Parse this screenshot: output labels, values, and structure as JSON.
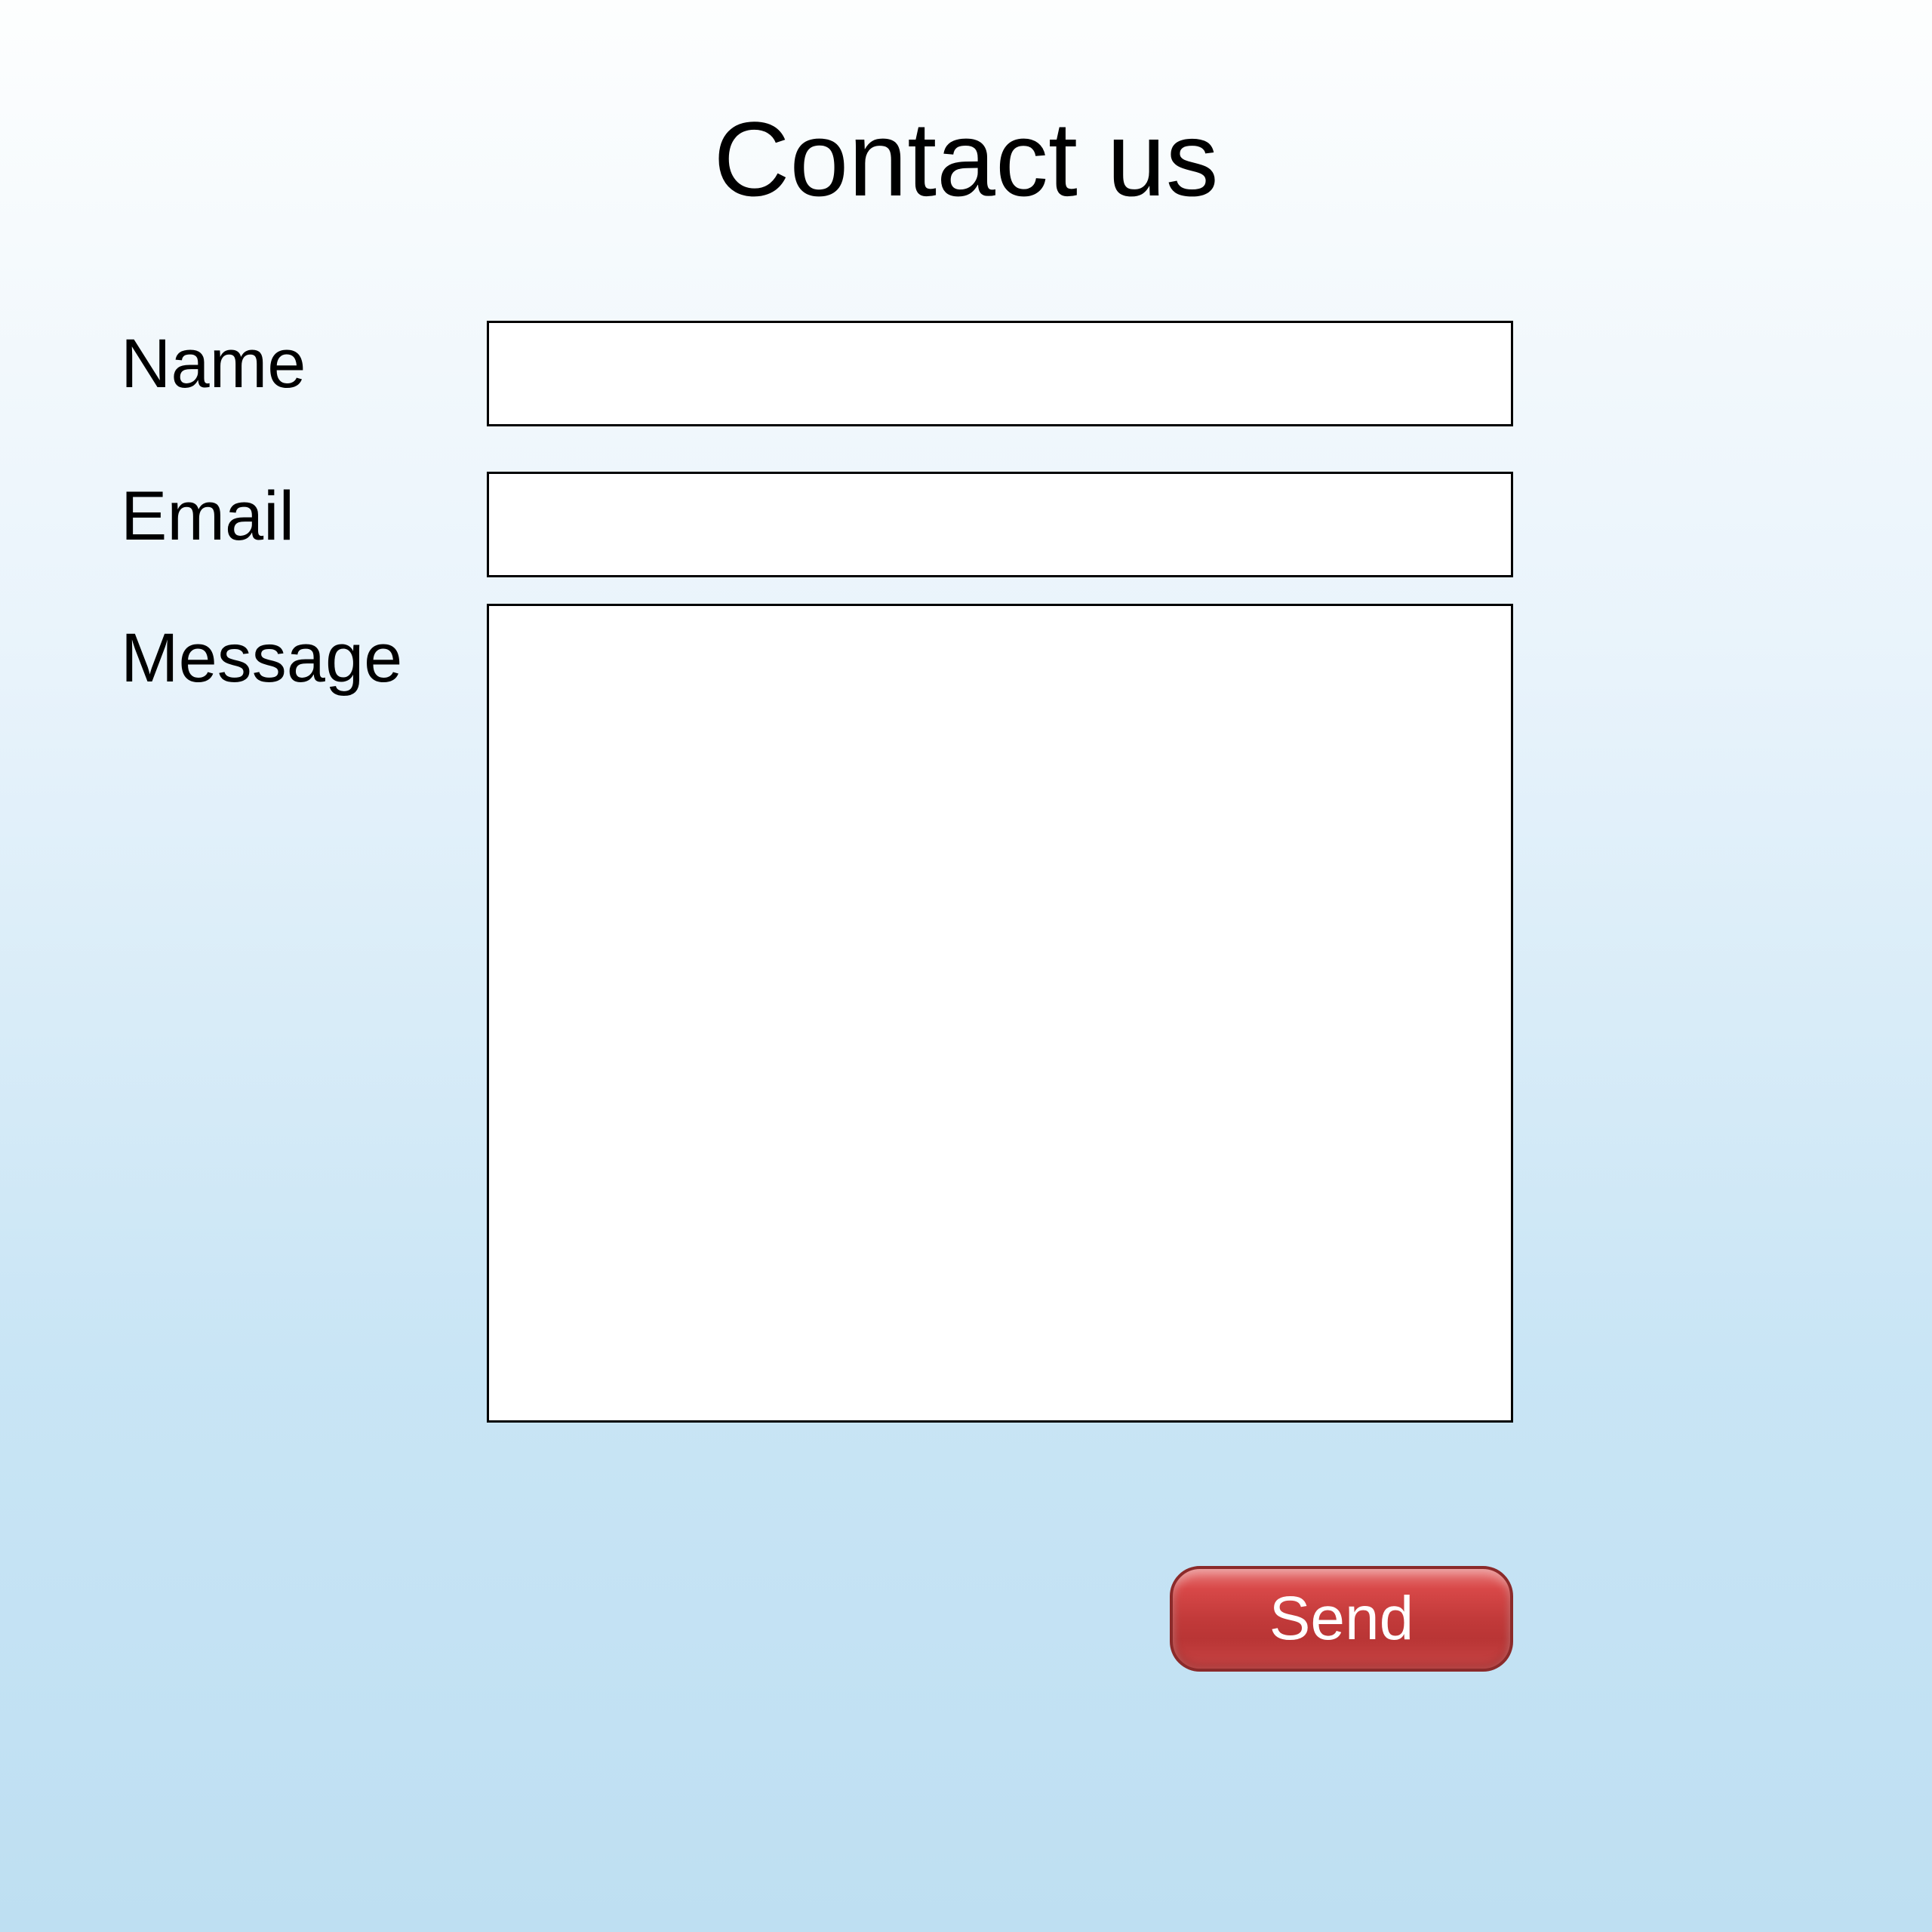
{
  "form": {
    "title": "Contact us",
    "name_label": "Name",
    "email_label": "Email",
    "message_label": "Message",
    "name_value": "",
    "email_value": "",
    "message_value": "",
    "send_button_label": "Send"
  }
}
